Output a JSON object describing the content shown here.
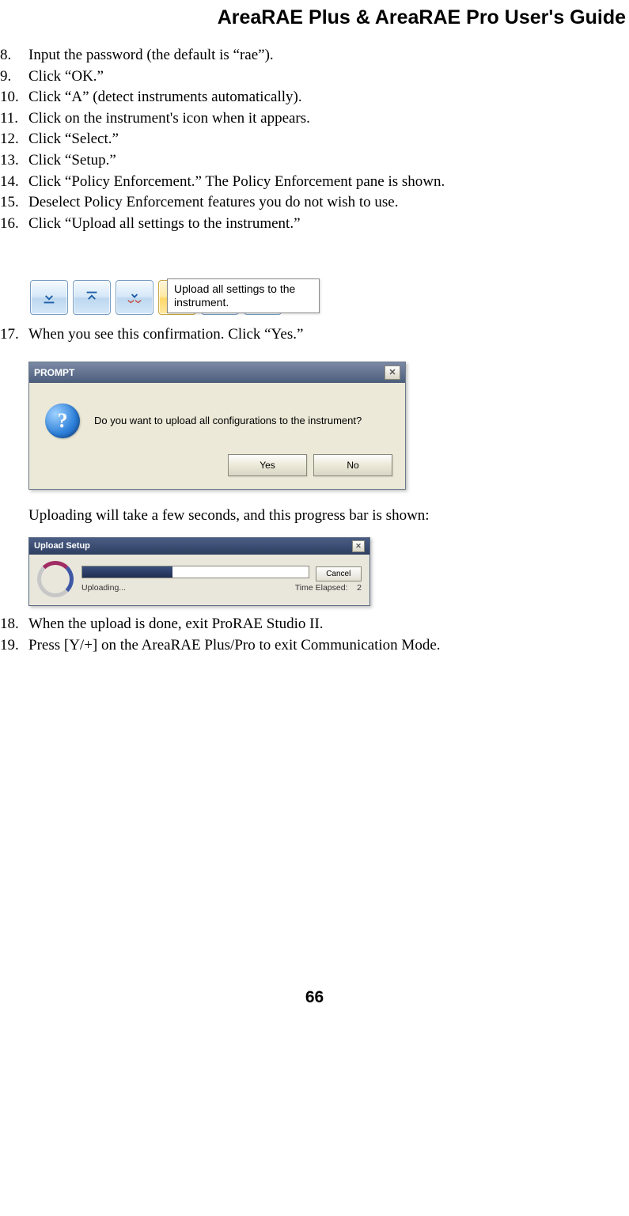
{
  "header": "AreaRAE Plus & AreaRAE Pro User's Guide",
  "steps_a": [
    {
      "n": "8.",
      "t": "Input the password (the default is “rae”)."
    },
    {
      "n": "9.",
      "t": "Click “OK.”"
    },
    {
      "n": "10.",
      "t": "Click “A” (detect instruments automatically)."
    },
    {
      "n": "11.",
      "t": "Click on the instrument's icon when it appears."
    },
    {
      "n": "12.",
      "t": "Click “Select.”"
    },
    {
      "n": "13.",
      "t": "Click “Setup.”"
    },
    {
      "n": "14.",
      "t": "Click “Policy Enforcement.” The Policy Enforcement pane is shown."
    },
    {
      "n": "15.",
      "t": "Deselect Policy Enforcement features you do not wish to use."
    },
    {
      "n": "16.",
      "t": "Click “Upload all settings to the instrument.”"
    }
  ],
  "tooltip_text": "Upload all settings to the instrument.",
  "step17": "When you see this confirmation. Click “Yes.”",
  "prompt": {
    "title": "PROMPT",
    "message": "Do you want to upload all configurations to the instrument?",
    "yes": "Yes",
    "no": "No"
  },
  "para_progress": "Uploading will take a few seconds, and this progress bar is shown:",
  "progress": {
    "title": "Upload Setup",
    "status": "Uploading...",
    "elapsed_label": "Time Elapsed:",
    "elapsed_val": "2",
    "cancel": "Cancel"
  },
  "steps_b": [
    {
      "n": "18.",
      "t": "When the upload is done, exit ProRAE Studio II."
    },
    {
      "n": "19.",
      "t": "Press [Y/+] on the AreaRAE Plus/Pro to exit Communication Mode."
    }
  ],
  "page_num": "66",
  "icons": {
    "download": "download-icon",
    "upload": "upload-icon",
    "download_all": "download-all-icon",
    "upload_all": "upload-all-icon",
    "wrench": "wrench-icon",
    "redo": "redo-icon"
  }
}
